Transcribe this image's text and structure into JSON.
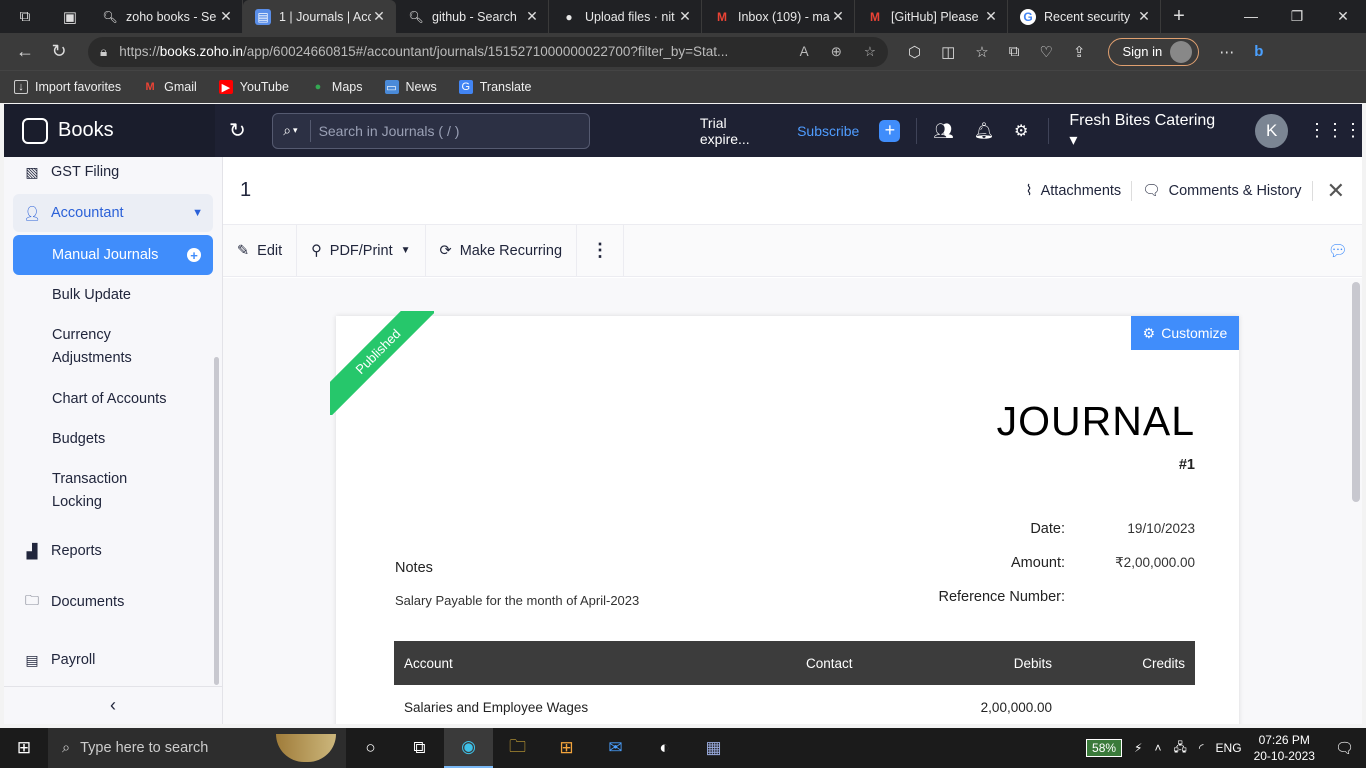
{
  "browser": {
    "tabs": [
      {
        "title": "zoho books - Se",
        "icon": "search-icon",
        "active": false
      },
      {
        "title": "1 | Journals | Acc",
        "icon": "zoho-books-icon",
        "active": true
      },
      {
        "title": "github - Search",
        "icon": "search-icon",
        "active": false
      },
      {
        "title": "Upload files · nit",
        "icon": "github-icon",
        "active": false
      },
      {
        "title": "Inbox (109) - ma",
        "icon": "gmail-icon",
        "active": false
      },
      {
        "title": "[GitHub] Please",
        "icon": "gmail-icon",
        "active": false
      },
      {
        "title": "Recent security",
        "icon": "google-icon",
        "active": false
      }
    ],
    "url_prefix": "https://",
    "url_host": "books.zoho.in",
    "url_path": "/app/60024660815#/accountant/journals/1515271000000022700?filter_by=Stat...",
    "signin_label": "Sign in",
    "bookmarks": [
      {
        "label": "Import favorites",
        "icon": "import-icon"
      },
      {
        "label": "Gmail",
        "icon": "gmail-icon"
      },
      {
        "label": "YouTube",
        "icon": "youtube-icon"
      },
      {
        "label": "Maps",
        "icon": "maps-icon"
      },
      {
        "label": "News",
        "icon": "news-icon"
      },
      {
        "label": "Translate",
        "icon": "translate-icon"
      }
    ]
  },
  "app": {
    "brand": "Books",
    "search_placeholder": "Search in Journals ( / )",
    "trial": "Trial expire...",
    "subscribe": "Subscribe",
    "org": "Fresh Bites Catering",
    "avatar_initial": "K",
    "accent": "#408dfb"
  },
  "sidebar": {
    "gst": "GST Filing",
    "accountant": "Accountant",
    "items": [
      {
        "label": "Manual Journals",
        "active": true
      },
      {
        "label": "Bulk Update"
      },
      {
        "label": "Currency Adjustments"
      },
      {
        "label": "Chart of Accounts"
      },
      {
        "label": "Budgets"
      },
      {
        "label": "Transaction Locking"
      }
    ],
    "reports": "Reports",
    "documents": "Documents",
    "payroll": "Payroll"
  },
  "main": {
    "title": "1",
    "attachments": "Attachments",
    "comments": "Comments & History",
    "toolbar": {
      "edit": "Edit",
      "pdf": "PDF/Print",
      "recurring": "Make Recurring"
    },
    "ribbon": "Published",
    "customize": "Customize",
    "journal_title": "JOURNAL",
    "journal_number": "#1",
    "date_label": "Date:",
    "date_value": "19/10/2023",
    "amount_label": "Amount:",
    "amount_value": "₹2,00,000.00",
    "ref_label": "Reference Number:",
    "ref_value": "",
    "notes_label": "Notes",
    "notes_text": "Salary Payable for the month of April-2023",
    "table": {
      "headers": [
        "Account",
        "Contact",
        "Debits",
        "Credits"
      ],
      "rows": [
        [
          "Salaries and Employee Wages",
          "",
          "2,00,000.00",
          ""
        ]
      ]
    }
  },
  "taskbar": {
    "search_placeholder": "Type here to search",
    "battery": "58%",
    "lang": "ENG",
    "time": "07:26 PM",
    "date": "20-10-2023"
  }
}
